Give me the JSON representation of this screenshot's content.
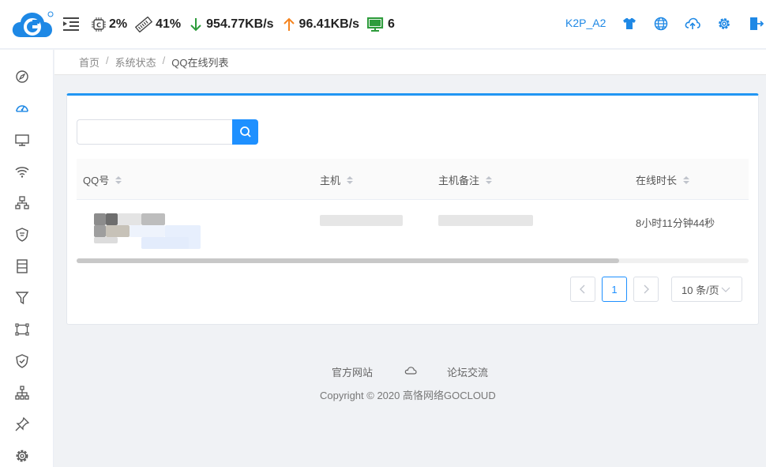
{
  "header": {
    "stats": {
      "cpu": "2%",
      "memory": "41%",
      "download": "954.77KB/s",
      "upload": "96.41KB/s",
      "devices": "6"
    },
    "device_name": "K2P_A2"
  },
  "breadcrumb": {
    "home": "首页",
    "system_status": "系统状态",
    "current": "QQ在线列表",
    "separator": "/"
  },
  "search": {
    "value": "",
    "placeholder": ""
  },
  "table": {
    "columns": [
      "QQ号",
      "主机",
      "主机备注",
      "在线时长"
    ],
    "rows": [
      {
        "qq": "",
        "host": "",
        "host_note": "",
        "online_duration": "8小时11分钟44秒"
      }
    ]
  },
  "pagination": {
    "current_page": "1",
    "page_size": "10 条/页"
  },
  "footer": {
    "official_site": "官方网站",
    "forum": "论坛交流",
    "copyright": "Copyright © 2020 高恪网络GOCLOUD"
  },
  "colors": {
    "accent": "#1e90ff",
    "download_arrow": "#2e9c3c",
    "upload_arrow": "#f5841f",
    "monitor": "#2e9c3c"
  }
}
